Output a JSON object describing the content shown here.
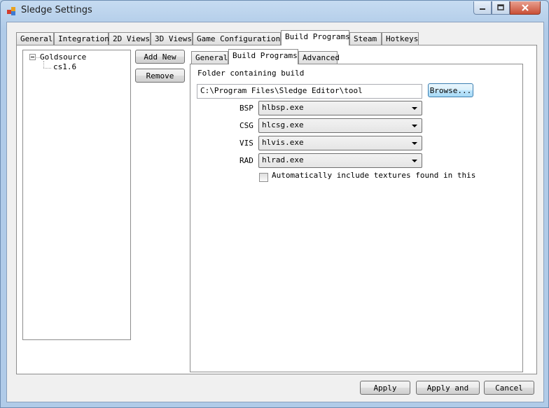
{
  "window": {
    "title": "Sledge Settings"
  },
  "main_tabs": [
    {
      "label": "General"
    },
    {
      "label": "Integration"
    },
    {
      "label": "2D Views"
    },
    {
      "label": "3D Views"
    },
    {
      "label": "Game Configurations"
    },
    {
      "label": "Build Programs"
    },
    {
      "label": "Steam"
    },
    {
      "label": "Hotkeys"
    }
  ],
  "active_main_tab": "Build Programs",
  "tree": {
    "root": "Goldsource",
    "child": "cs1.6"
  },
  "buttons": {
    "add_new": "Add New",
    "remove": "Remove",
    "browse": "Browse...",
    "apply": "Apply",
    "apply_and": "Apply and",
    "cancel": "Cancel"
  },
  "sub_tabs": [
    {
      "label": "General"
    },
    {
      "label": "Build Programs"
    },
    {
      "label": "Advanced"
    }
  ],
  "active_sub_tab": "Build Programs",
  "build": {
    "folder_label": "Folder containing build",
    "folder_value": "C:\\Program Files\\Sledge Editor\\tool",
    "bsp_label": "BSP",
    "bsp_value": "hlbsp.exe",
    "csg_label": "CSG",
    "csg_value": "hlcsg.exe",
    "vis_label": "VIS",
    "vis_value": "hlvis.exe",
    "rad_label": "RAD",
    "rad_value": "hlrad.exe",
    "auto_textures_label": "Automatically include textures found in this",
    "auto_textures_checked": false
  }
}
